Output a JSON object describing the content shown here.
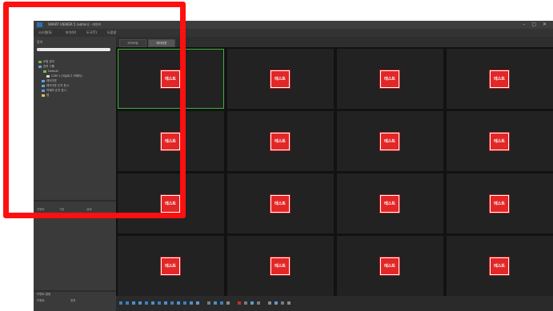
{
  "window": {
    "title": "SMART VIEWER 5 (admin) · 라이브",
    "controls": "– ▢ ✕"
  },
  "menu": [
    "시스템(S)",
    "보기(V)",
    "도구(T)",
    "도움말"
  ],
  "sidebar": {
    "title": "장치",
    "search_icon": "⌕",
    "tree": [
      {
        "label": "로컬 장치",
        "icon_color": "#7fae4a"
      },
      {
        "label": "장치 그룹",
        "icon_color": "#5fa0d8"
      },
      {
        "label": "Default",
        "icon_color": "#6cc24a"
      },
      {
        "label": "CAM 1 (아날로그 카메라)",
        "icon_color": "#d8d8d8"
      },
      {
        "label": "레이아웃",
        "icon_color": "#5fa0d8"
      },
      {
        "label": "레이아웃 순차 표시",
        "icon_color": "#5fa0d8"
      },
      {
        "label": "카메라 순차 표시",
        "icon_color": "#5fa0d8"
      },
      {
        "label": "맵",
        "icon_color": "#e0c050"
      }
    ],
    "columns": [
      "이벤트",
      "기본",
      "상태"
    ],
    "bottom_section": {
      "title": "이벤트 알림",
      "columns": [
        "이벤트",
        "장치"
      ]
    }
  },
  "tabs": [
    {
      "label": "라이브뷰"
    },
    {
      "label": "레이아웃"
    }
  ],
  "grid": {
    "badge_text": "테스트",
    "selected_cell": 0,
    "cells": 16
  },
  "highlight_color": "#ff1010"
}
